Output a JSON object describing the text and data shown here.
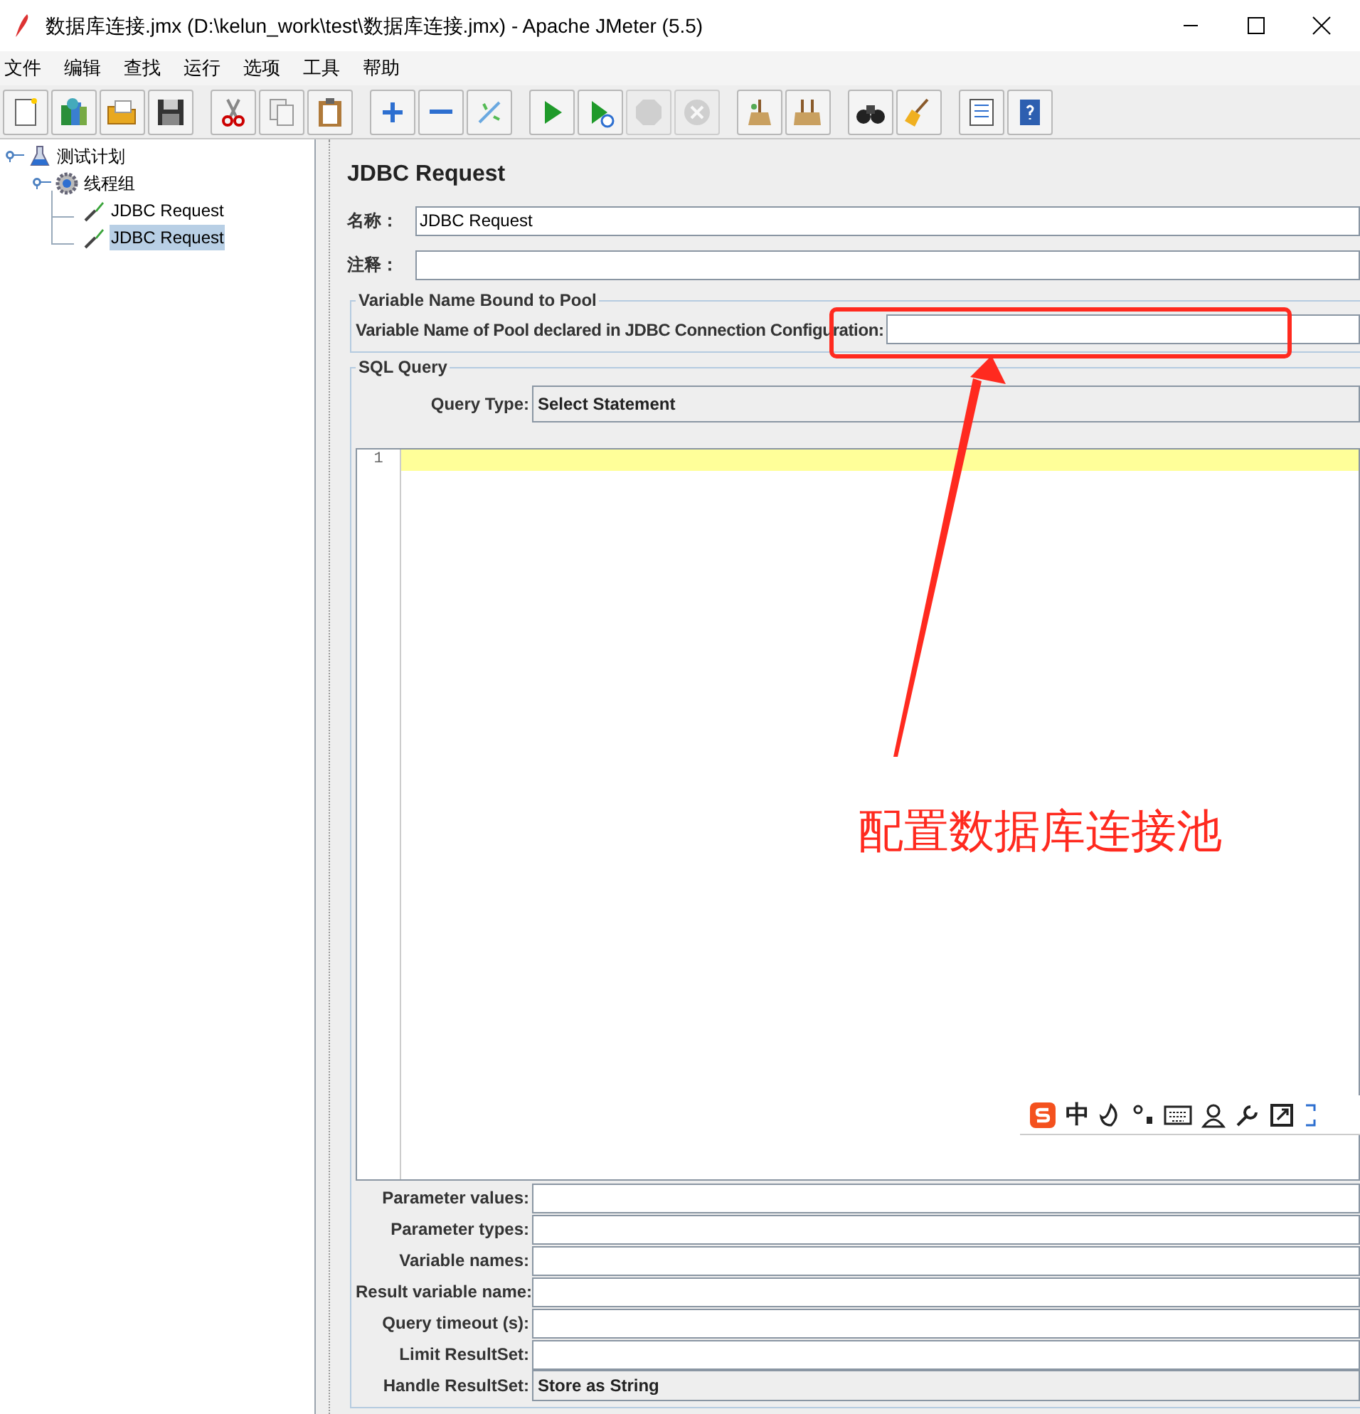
{
  "window": {
    "title": "数据库连接.jmx (D:\\kelun_work\\test\\数据库连接.jmx) - Apache JMeter (5.5)"
  },
  "menu": [
    "文件",
    "编辑",
    "查找",
    "运行",
    "选项",
    "工具",
    "帮助"
  ],
  "toolbar": [
    {
      "kind": "new",
      "disabled": false
    },
    {
      "kind": "templates",
      "disabled": false
    },
    {
      "kind": "open",
      "disabled": false
    },
    {
      "kind": "save",
      "disabled": false
    },
    {
      "kind": "sep"
    },
    {
      "kind": "cut",
      "disabled": false
    },
    {
      "kind": "copy",
      "disabled": false
    },
    {
      "kind": "paste",
      "disabled": false
    },
    {
      "kind": "sep"
    },
    {
      "kind": "add",
      "disabled": false
    },
    {
      "kind": "remove",
      "disabled": false
    },
    {
      "kind": "toggle",
      "disabled": false
    },
    {
      "kind": "sep"
    },
    {
      "kind": "start",
      "disabled": false
    },
    {
      "kind": "start_no_timers",
      "disabled": false
    },
    {
      "kind": "stop",
      "disabled": true
    },
    {
      "kind": "shutdown",
      "disabled": true
    },
    {
      "kind": "sep"
    },
    {
      "kind": "clear",
      "disabled": false
    },
    {
      "kind": "clear_all",
      "disabled": false
    },
    {
      "kind": "sep"
    },
    {
      "kind": "search",
      "disabled": false
    },
    {
      "kind": "reset_search",
      "disabled": false
    },
    {
      "kind": "sep"
    },
    {
      "kind": "functions",
      "disabled": false
    },
    {
      "kind": "help",
      "disabled": false
    }
  ],
  "tree": [
    {
      "label": "测试计划",
      "kind": "plan",
      "selected": false,
      "expanded": true,
      "children": [
        {
          "label": "线程组",
          "kind": "group",
          "selected": false,
          "expanded": true,
          "children": [
            {
              "label": "JDBC Request",
              "kind": "sampler",
              "selected": false
            },
            {
              "label": "JDBC Request",
              "kind": "sampler",
              "selected": true
            }
          ]
        }
      ]
    }
  ],
  "form": {
    "title": "JDBC Request",
    "fields": [
      {
        "label": "名称：",
        "value": "JDBC Request"
      },
      {
        "label": "注释："
      }
    ]
  },
  "pool_section": {
    "legend": "Variable Name Bound to Pool",
    "label": "Variable Name of Pool declared in JDBC Connection Configuration:"
  },
  "sql_section": {
    "legend": "SQL Query",
    "query_type": {
      "label": "Query Type:",
      "value": "Select Statement"
    },
    "editor": {
      "line_numbers": [
        "1"
      ]
    },
    "params": [
      {
        "label": "Parameter values:",
        "kind": "text"
      },
      {
        "label": "Parameter types:",
        "kind": "text"
      },
      {
        "label": "Variable names:",
        "kind": "text"
      },
      {
        "label": "Result variable name:",
        "kind": "text"
      },
      {
        "label": "Query timeout (s):",
        "kind": "text"
      },
      {
        "label": "Limit ResultSet:",
        "kind": "text"
      },
      {
        "label": "Handle ResultSet:",
        "kind": "combo",
        "value": "Store as String"
      }
    ]
  },
  "annotation": {
    "text": "配置数据库连接池"
  },
  "ime_toolbar": {
    "mode": "中"
  }
}
